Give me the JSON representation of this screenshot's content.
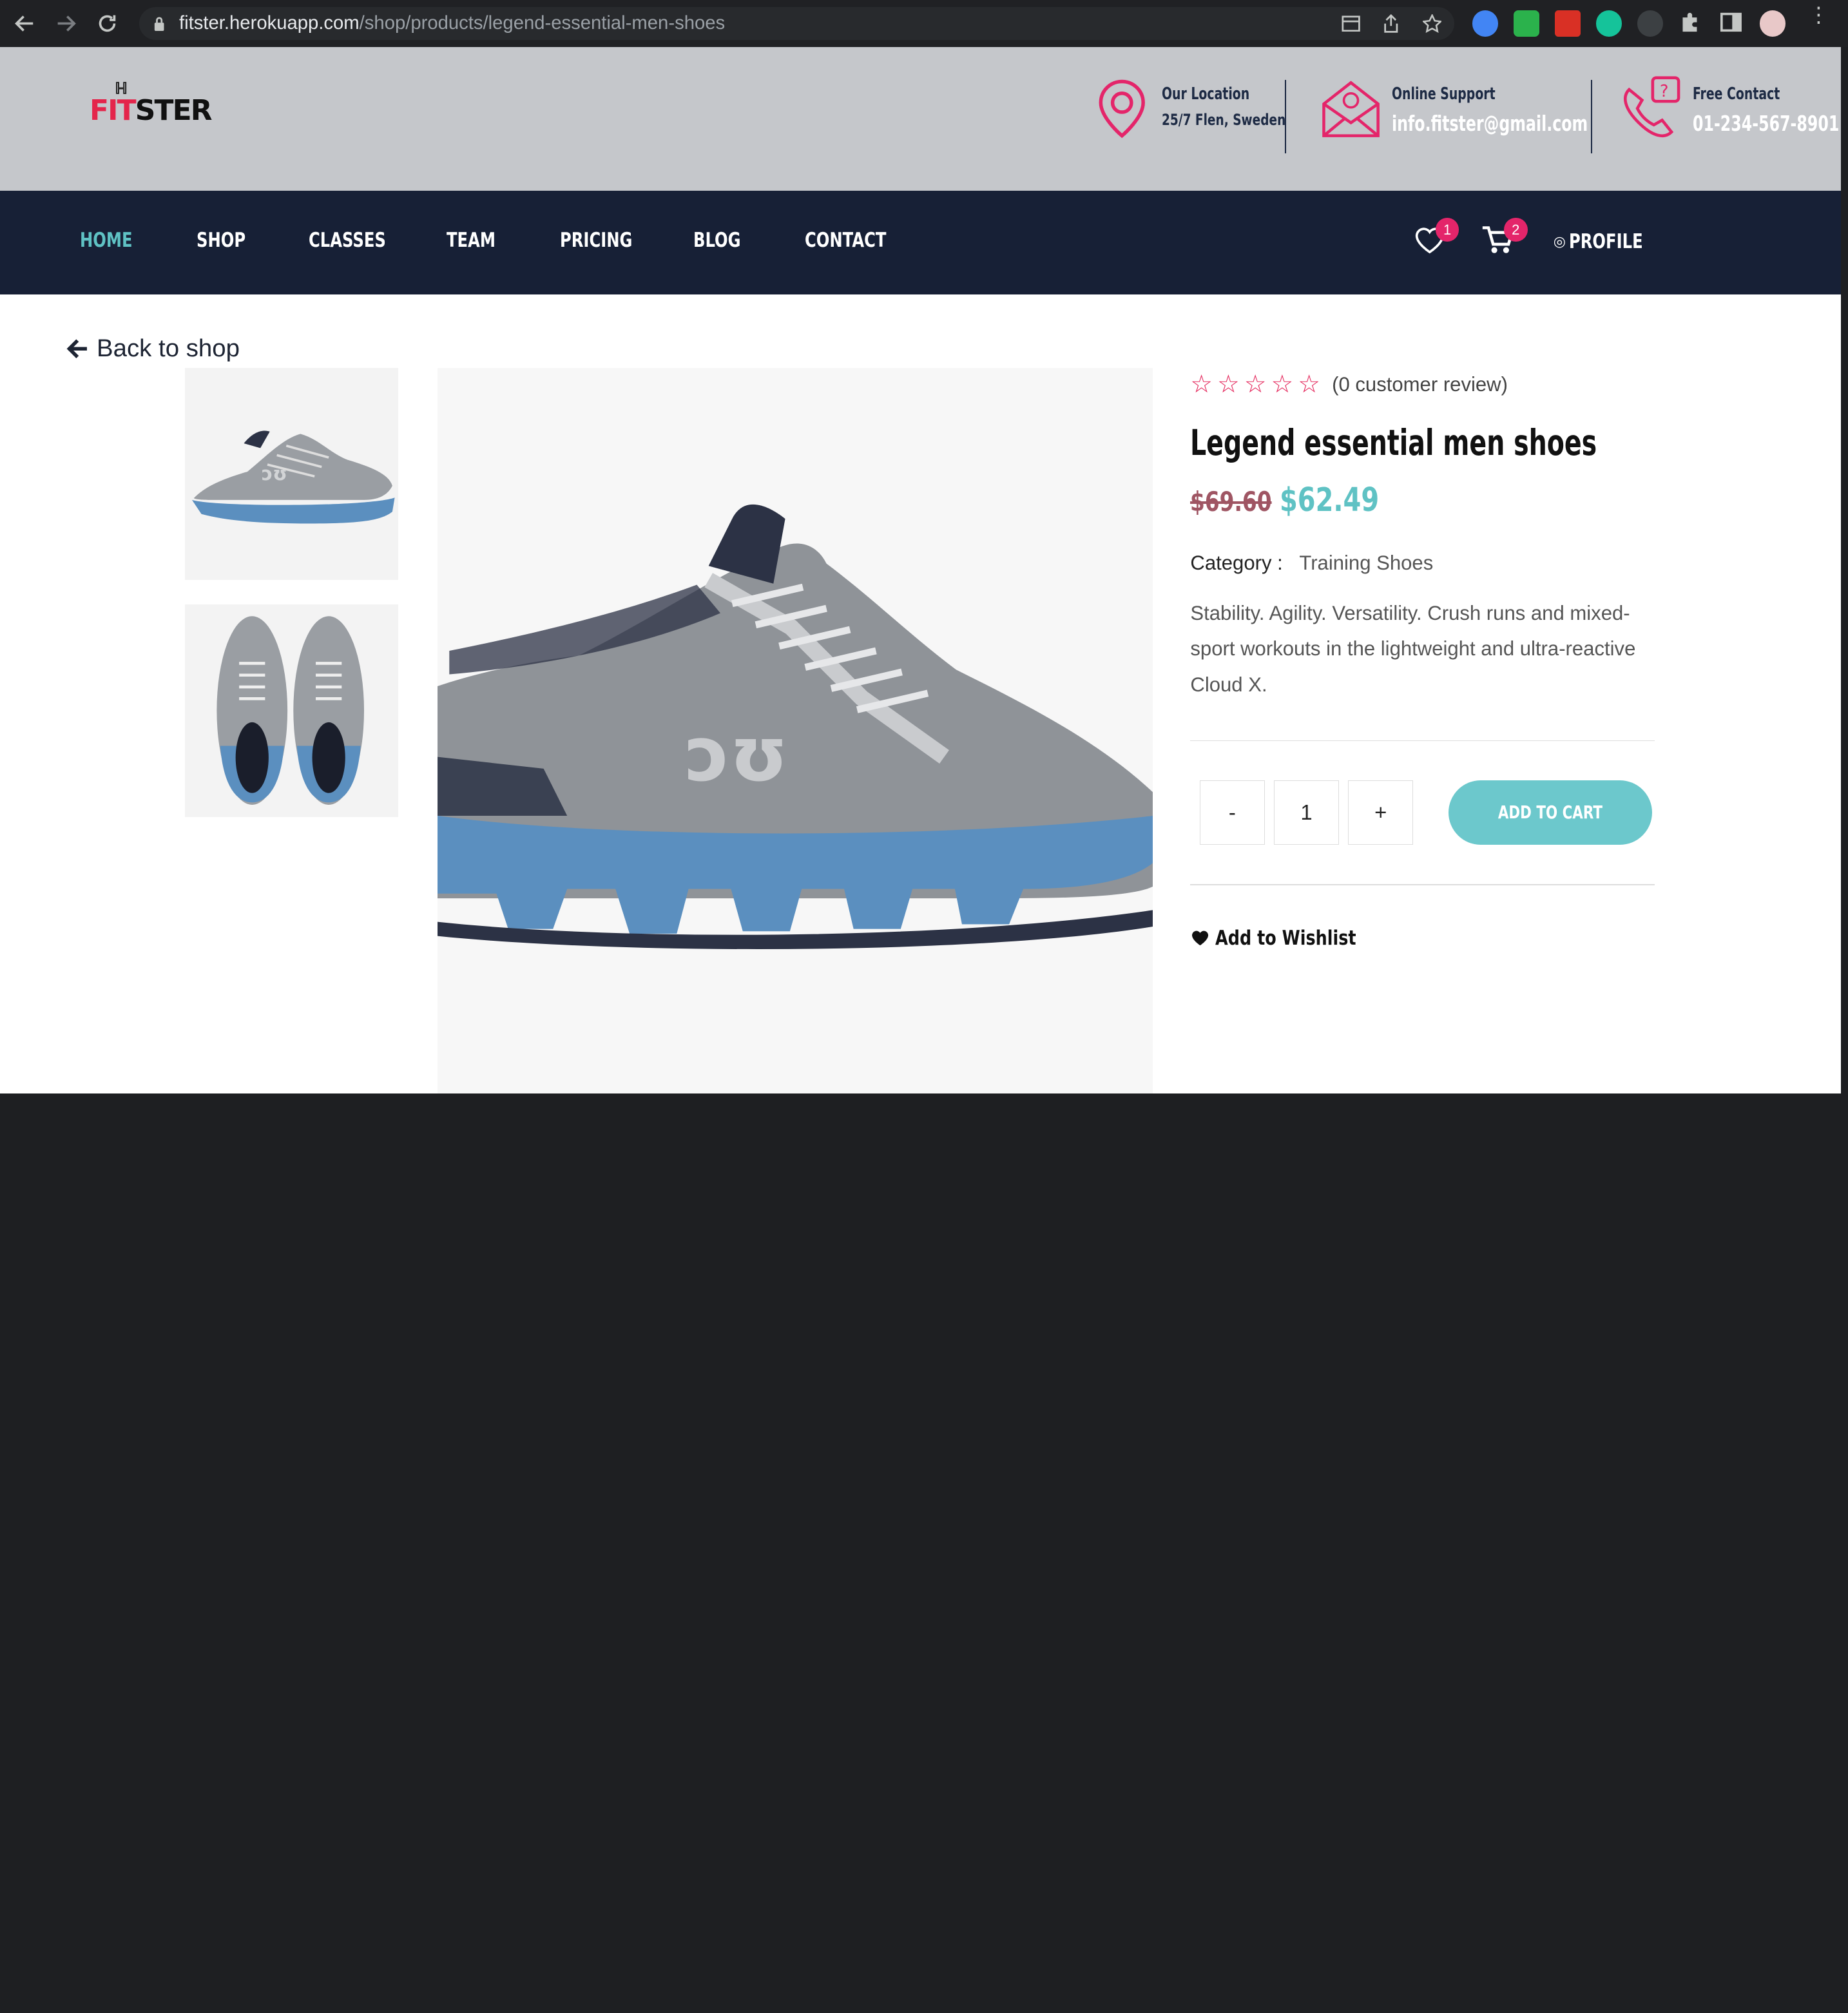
{
  "browser": {
    "url_host": "fitster.herokuapp.com",
    "url_path": "/shop/products/legend-essential-men-shoes"
  },
  "header": {
    "logo_fit": "FIT",
    "logo_ster": "STER",
    "location_title": "Our Location",
    "location_value": "25/7 Flen, Sweden",
    "support_title": "Online Support",
    "support_value": "info.fitster@gmail.com",
    "contact_title": "Free Contact",
    "contact_value": "01-234-567-8901"
  },
  "nav": {
    "items": [
      "HOME",
      "SHOP",
      "CLASSES",
      "TEAM",
      "PRICING",
      "BLOG",
      "CONTACT"
    ],
    "wishlist_count": "1",
    "cart_count": "2",
    "profile_label": "PROFILE"
  },
  "product": {
    "back_label": "Back to shop",
    "review_text": "(0 customer review)",
    "rating": 0,
    "title": "Legend essential men shoes",
    "old_price": "$69.60",
    "new_price": "$62.49",
    "category_label": "Category :",
    "category_value": "Training Shoes",
    "description": "Stability. Agility. Versatility. Crush runs and mixed-sport workouts in the lightweight and ultra-reactive Cloud X.",
    "qty_minus": "-",
    "qty_value": "1",
    "qty_plus": "+",
    "add_to_cart": "ADD TO CART",
    "add_to_wishlist": "Add to Wishlist"
  },
  "colors": {
    "accent_teal": "#5fc2c4",
    "accent_pink": "#e4256a",
    "navbar_bg": "#172036",
    "topbar_bg": "#c5c7cb"
  }
}
